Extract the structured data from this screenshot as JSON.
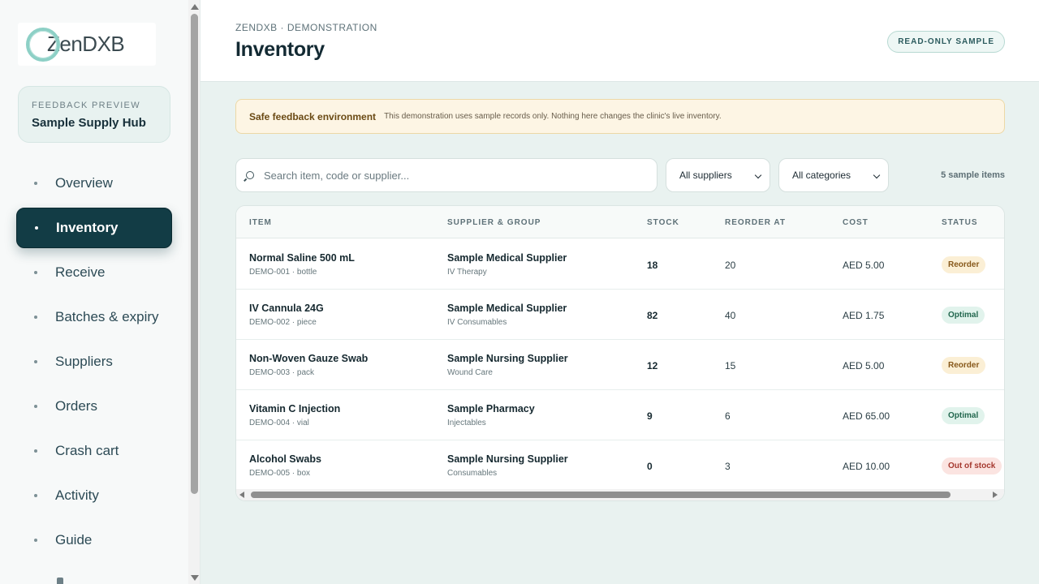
{
  "brand": {
    "logo_text": "ZenDXB"
  },
  "sidebar": {
    "hub_eyebrow": "FEEDBACK PREVIEW",
    "hub_title": "Sample Supply Hub",
    "items": [
      {
        "label": "Overview",
        "active": false
      },
      {
        "label": "Inventory",
        "active": true
      },
      {
        "label": "Receive",
        "active": false
      },
      {
        "label": "Batches & expiry",
        "active": false
      },
      {
        "label": "Suppliers",
        "active": false
      },
      {
        "label": "Orders",
        "active": false
      },
      {
        "label": "Crash cart",
        "active": false
      },
      {
        "label": "Activity",
        "active": false
      },
      {
        "label": "Guide",
        "active": false
      }
    ]
  },
  "header": {
    "breadcrumb": "ZENDXB · DEMONSTRATION",
    "title": "Inventory",
    "badge": "READ-ONLY SAMPLE"
  },
  "notice": {
    "title": "Safe feedback environment",
    "text": "This demonstration uses sample records only. Nothing here changes the clinic's live inventory."
  },
  "filters": {
    "search_placeholder": "Search item, code or supplier...",
    "supplier_select": "All suppliers",
    "category_select": "All categories",
    "count": "5 sample items"
  },
  "table": {
    "columns": [
      "ITEM",
      "SUPPLIER & GROUP",
      "STOCK",
      "REORDER AT",
      "COST",
      "STATUS"
    ],
    "rows": [
      {
        "name": "Normal Saline 500 mL",
        "code": "DEMO-001 · bottle",
        "supplier": "Sample Medical Supplier",
        "group": "IV Therapy",
        "stock": "18",
        "reorder": "20",
        "cost": "AED 5.00",
        "status": "Reorder",
        "status_type": "reorder"
      },
      {
        "name": "IV Cannula 24G",
        "code": "DEMO-002 · piece",
        "supplier": "Sample Medical Supplier",
        "group": "IV Consumables",
        "stock": "82",
        "reorder": "40",
        "cost": "AED 1.75",
        "status": "Optimal",
        "status_type": "optimal"
      },
      {
        "name": "Non-Woven Gauze Swab",
        "code": "DEMO-003 · pack",
        "supplier": "Sample Nursing Supplier",
        "group": "Wound Care",
        "stock": "12",
        "reorder": "15",
        "cost": "AED 5.00",
        "status": "Reorder",
        "status_type": "reorder"
      },
      {
        "name": "Vitamin C Injection",
        "code": "DEMO-004 · vial",
        "supplier": "Sample Pharmacy",
        "group": "Injectables",
        "stock": "9",
        "reorder": "6",
        "cost": "AED 65.00",
        "status": "Optimal",
        "status_type": "optimal"
      },
      {
        "name": "Alcohol Swabs",
        "code": "DEMO-005 · box",
        "supplier": "Sample Nursing Supplier",
        "group": "Consumables",
        "stock": "0",
        "reorder": "3",
        "cost": "AED 10.00",
        "status": "Out of stock",
        "status_type": "out"
      }
    ]
  },
  "colors": {
    "sidebar_active": "#123c45",
    "accent": "#4a8f8a",
    "reorder": "#87581a",
    "optimal": "#22674e",
    "out_of_stock": "#a5392f"
  }
}
